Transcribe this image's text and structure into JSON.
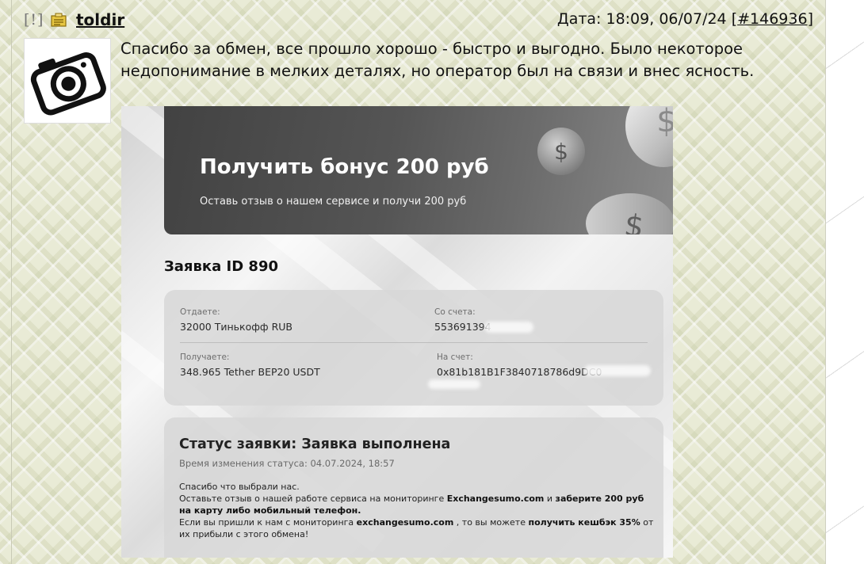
{
  "post": {
    "flag": "[!]",
    "username": "toldir",
    "date_label": "Дата: 18:09, 06/07/24",
    "post_link": "#146936",
    "message_line1": "Спасибо за обмен, все прошло хорошо - быстро и выгодно. Было некоторое",
    "message_line2": "недопонимание в мелких деталях, но оператор был на связи и внес ясность."
  },
  "screenshot": {
    "banner_title": "Получить бонус 200 руб",
    "banner_subtitle": "Оставь отзыв о нашем сервисе и получи 200 руб",
    "order_title": "Заявка ID 890",
    "give_label": "Отдаете:",
    "give_value": "32000 Тинькофф RUB",
    "from_account_label": "Со счета:",
    "from_account_value": "553691394",
    "receive_label": "Получаете:",
    "receive_value": "348.965 Tether BEP20 USDT",
    "to_account_label": "На счет:",
    "to_account_value": "0x81b181B1F3840718786d9DC0",
    "status_label": "Статус заявки:",
    "status_value": "Заявка выполнена",
    "status_time": "Время изменения статуса: 04.07.2024, 18:57",
    "thanks": "Спасибо что выбрали нас.",
    "review_prefix": "Оставьте отзыв о нашей работе сервиса на мониторинге",
    "review_site": "Exchangesumo.com",
    "review_and": "и",
    "review_bonus": "заберите 200 руб на карту либо мобильный телефон.",
    "cashback_prefix": "Если вы пришли к нам с мониторинга",
    "cashback_site": "exchangesumo.com",
    "cashback_mid": ", то вы можете",
    "cashback_bold": "получить кешбэк 35%",
    "cashback_suffix": "от их прибыли с этого обмена!"
  },
  "colors": {
    "banner": "#4a4a4a",
    "card": "#d7d7d7",
    "page_bg": "#e9ebd6"
  },
  "icons": [
    "envelope-icon",
    "camera-icon",
    "dollar-coin-icon"
  ]
}
